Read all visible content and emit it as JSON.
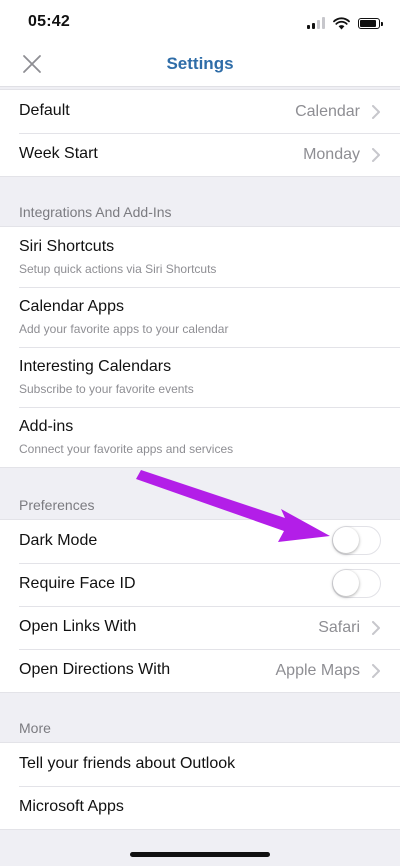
{
  "status_bar": {
    "time": "05:42"
  },
  "nav": {
    "title": "Settings"
  },
  "calendar_group": {
    "rows": [
      {
        "label": "Default",
        "value": "Calendar"
      },
      {
        "label": "Week Start",
        "value": "Monday"
      }
    ]
  },
  "integrations": {
    "header": "Integrations And Add-Ins",
    "rows": [
      {
        "label": "Siri Shortcuts",
        "subtitle": "Setup quick actions via Siri Shortcuts"
      },
      {
        "label": "Calendar Apps",
        "subtitle": "Add your favorite apps to your calendar"
      },
      {
        "label": "Interesting Calendars",
        "subtitle": "Subscribe to your favorite events"
      },
      {
        "label": "Add-ins",
        "subtitle": "Connect your favorite apps and services"
      }
    ]
  },
  "preferences": {
    "header": "Preferences",
    "dark_mode": {
      "label": "Dark Mode",
      "on": false
    },
    "face_id": {
      "label": "Require Face ID",
      "on": false
    },
    "open_links": {
      "label": "Open Links With",
      "value": "Safari"
    },
    "open_directions": {
      "label": "Open Directions With",
      "value": "Apple Maps"
    }
  },
  "more": {
    "header": "More",
    "rows": [
      {
        "label": "Tell your friends about Outlook"
      },
      {
        "label": "Microsoft Apps"
      }
    ]
  },
  "colors": {
    "accent": "#2f6da8",
    "annotation_arrow": "#b31ee8",
    "background": "#efeff4"
  },
  "icons": [
    "close-icon",
    "chevron-right-icon",
    "wifi-icon",
    "battery-icon",
    "signal-icon"
  ]
}
